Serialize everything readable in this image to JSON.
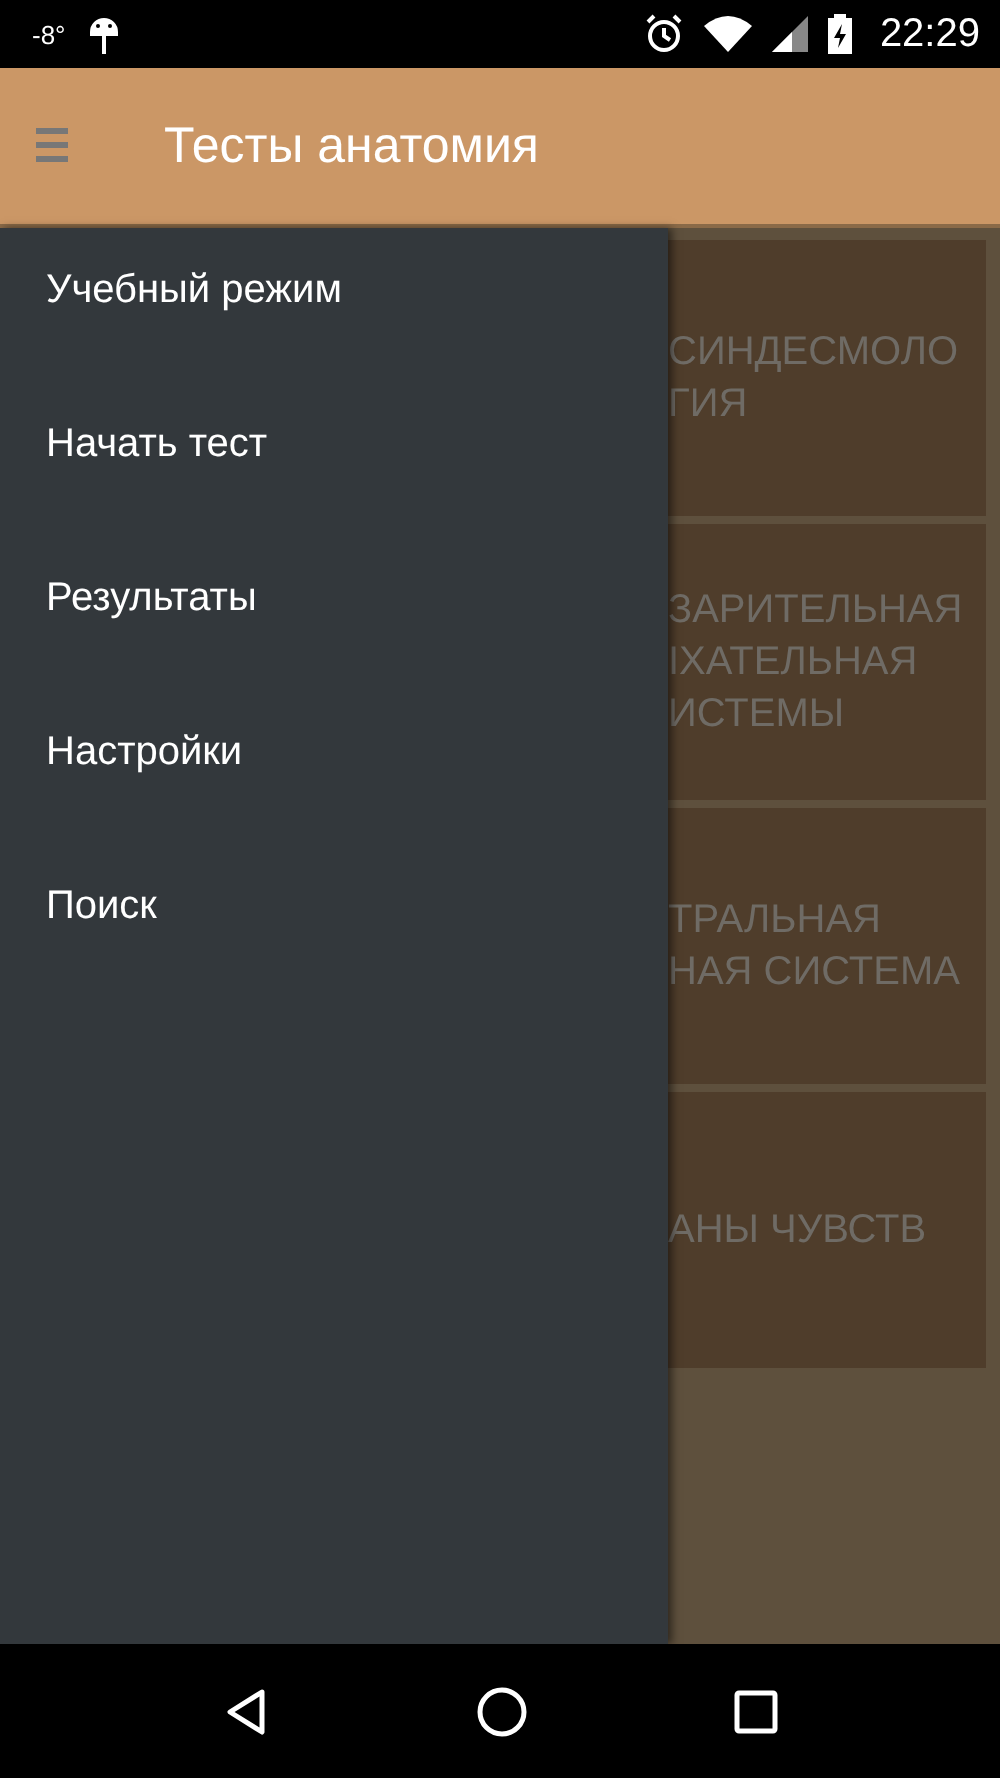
{
  "status_bar": {
    "temperature": "-8°",
    "time": "22:29"
  },
  "toolbar": {
    "title": "Тесты анатомия"
  },
  "drawer": {
    "items": [
      {
        "label": "Учебный режим"
      },
      {
        "label": "Начать тест"
      },
      {
        "label": "Результаты"
      },
      {
        "label": "Настройки"
      },
      {
        "label": "Поиск"
      }
    ]
  },
  "cards": [
    {
      "lines": [
        "СИНДЕСМОЛО",
        "ГИЯ"
      ]
    },
    {
      "lines": [
        "ЗАРИТЕЛЬНАЯ",
        "ІХАТЕЛЬНАЯ",
        "ИСТЕМЫ"
      ]
    },
    {
      "lines": [
        "ТРАЛЬНАЯ",
        "НАЯ СИСТЕМА"
      ]
    },
    {
      "lines": [
        "АНЫ ЧУВСТВ"
      ]
    }
  ]
}
